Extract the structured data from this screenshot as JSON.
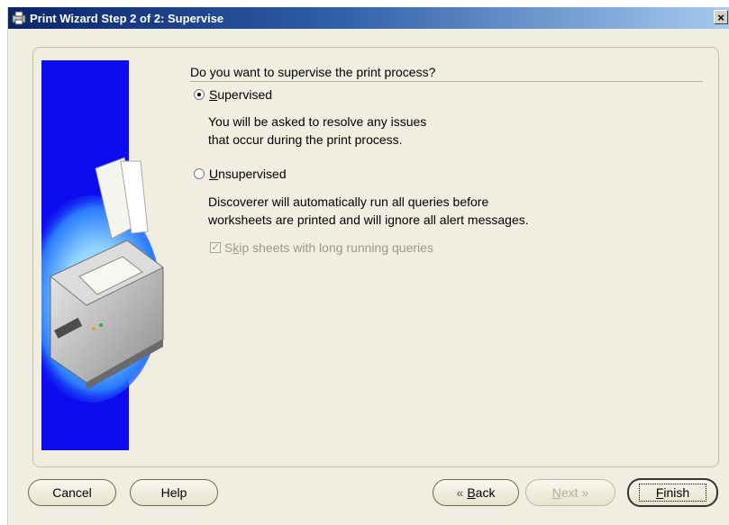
{
  "window": {
    "title": "Print Wizard Step 2 of 2: Supervise",
    "close_label": "×"
  },
  "question": "Do you want to supervise the print process?",
  "options": {
    "supervised": {
      "access_key": "S",
      "label_rest": "upervised",
      "selected": true,
      "desc_line1": "You will be asked to resolve any issues",
      "desc_line2": "that occur during the print process."
    },
    "unsupervised": {
      "access_key": "U",
      "label_rest": "nsupervised",
      "selected": false,
      "desc_line1": "Discoverer will automatically run all queries before",
      "desc_line2": "worksheets are printed and will ignore all alert messages."
    },
    "skip_long": {
      "label_pre": "S",
      "access_key": "k",
      "label_rest": "ip sheets with long running queries",
      "checked": true,
      "enabled": false
    }
  },
  "buttons": {
    "cancel": "Cancel",
    "help": "Help",
    "back_key": "B",
    "back_rest": "ack",
    "back_icon": "«",
    "next_key": "N",
    "next_rest": "ext",
    "next_icon": "»",
    "finish_key": "F",
    "finish_rest": "inish"
  },
  "colors": {
    "title_bar": "#0a246a",
    "side_panel": "#0c0cee",
    "dialog_bg": "#f0eee0"
  },
  "icons": [
    "print-wizard-icon",
    "close-icon",
    "printer-illustration"
  ]
}
